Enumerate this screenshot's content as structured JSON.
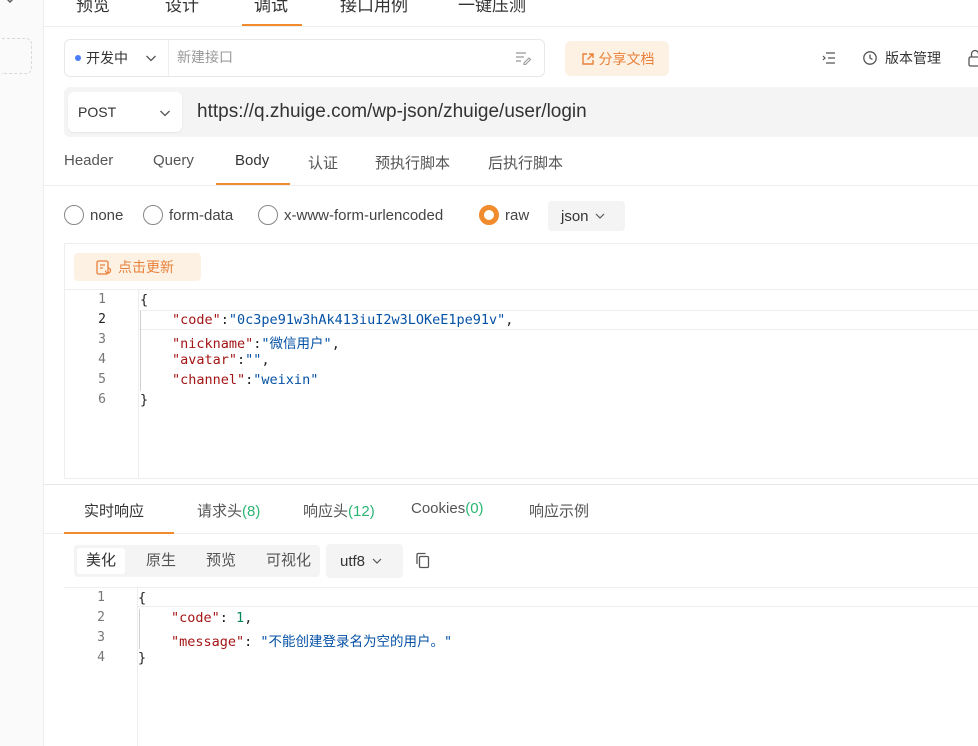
{
  "top_tabs": [
    {
      "label": "预览"
    },
    {
      "label": "设计"
    },
    {
      "label": "调试"
    },
    {
      "label": "接口用例"
    },
    {
      "label": "一键压测"
    }
  ],
  "env": {
    "label": "开发中"
  },
  "name_input": {
    "placeholder": "新建接口"
  },
  "share_label": "分享文档",
  "version_label": "版本管理",
  "request": {
    "method": "POST",
    "url": "https://q.zhuige.com/wp-json/zhuige/user/login"
  },
  "req_tabs": [
    {
      "label": "Header"
    },
    {
      "label": "Query"
    },
    {
      "label": "Body"
    },
    {
      "label": "认证"
    },
    {
      "label": "预执行脚本"
    },
    {
      "label": "后执行脚本"
    }
  ],
  "body_types": [
    {
      "label": "none"
    },
    {
      "label": "form-data"
    },
    {
      "label": "x-www-form-urlencoded"
    },
    {
      "label": "raw"
    }
  ],
  "body_format": "json",
  "update_label": "点击更新",
  "request_body": {
    "line_numbers": [
      "1",
      "2",
      "3",
      "4",
      "5",
      "6"
    ],
    "open": "{",
    "close": "}",
    "fields": [
      {
        "key": "\"code\"",
        "value": "\"0c3pe91w3hAk413iuI2w3LOKeE1pe91v\"",
        "trail": ","
      },
      {
        "key": "\"nickname\"",
        "value": "\"微信用户\"",
        "trail": ","
      },
      {
        "key": "\"avatar\"",
        "value": "\"\"",
        "trail": ","
      },
      {
        "key": "\"channel\"",
        "value": "\"weixin\"",
        "trail": ""
      }
    ]
  },
  "resp_tabs": [
    {
      "label": "实时响应",
      "count": ""
    },
    {
      "label": "请求头",
      "count": "(8)"
    },
    {
      "label": "响应头",
      "count": "(12)"
    },
    {
      "label": "Cookies",
      "count": "(0)"
    },
    {
      "label": "响应示例",
      "count": ""
    }
  ],
  "view_modes": [
    {
      "label": "美化"
    },
    {
      "label": "原生"
    },
    {
      "label": "预览"
    },
    {
      "label": "可视化"
    }
  ],
  "encoding": "utf8",
  "response_body": {
    "line_numbers": [
      "1",
      "2",
      "3",
      "4"
    ],
    "open": "{",
    "close": "}",
    "code_key": "\"code\"",
    "code_value": "1",
    "message_key": "\"message\"",
    "message_value": "\"不能创建登录名为空的用户。\""
  },
  "colors": {
    "accent": "#f08c2e",
    "count_green": "#2bb673",
    "json_key": "#a31515",
    "json_string": "#0451a5",
    "json_number": "#098658"
  }
}
